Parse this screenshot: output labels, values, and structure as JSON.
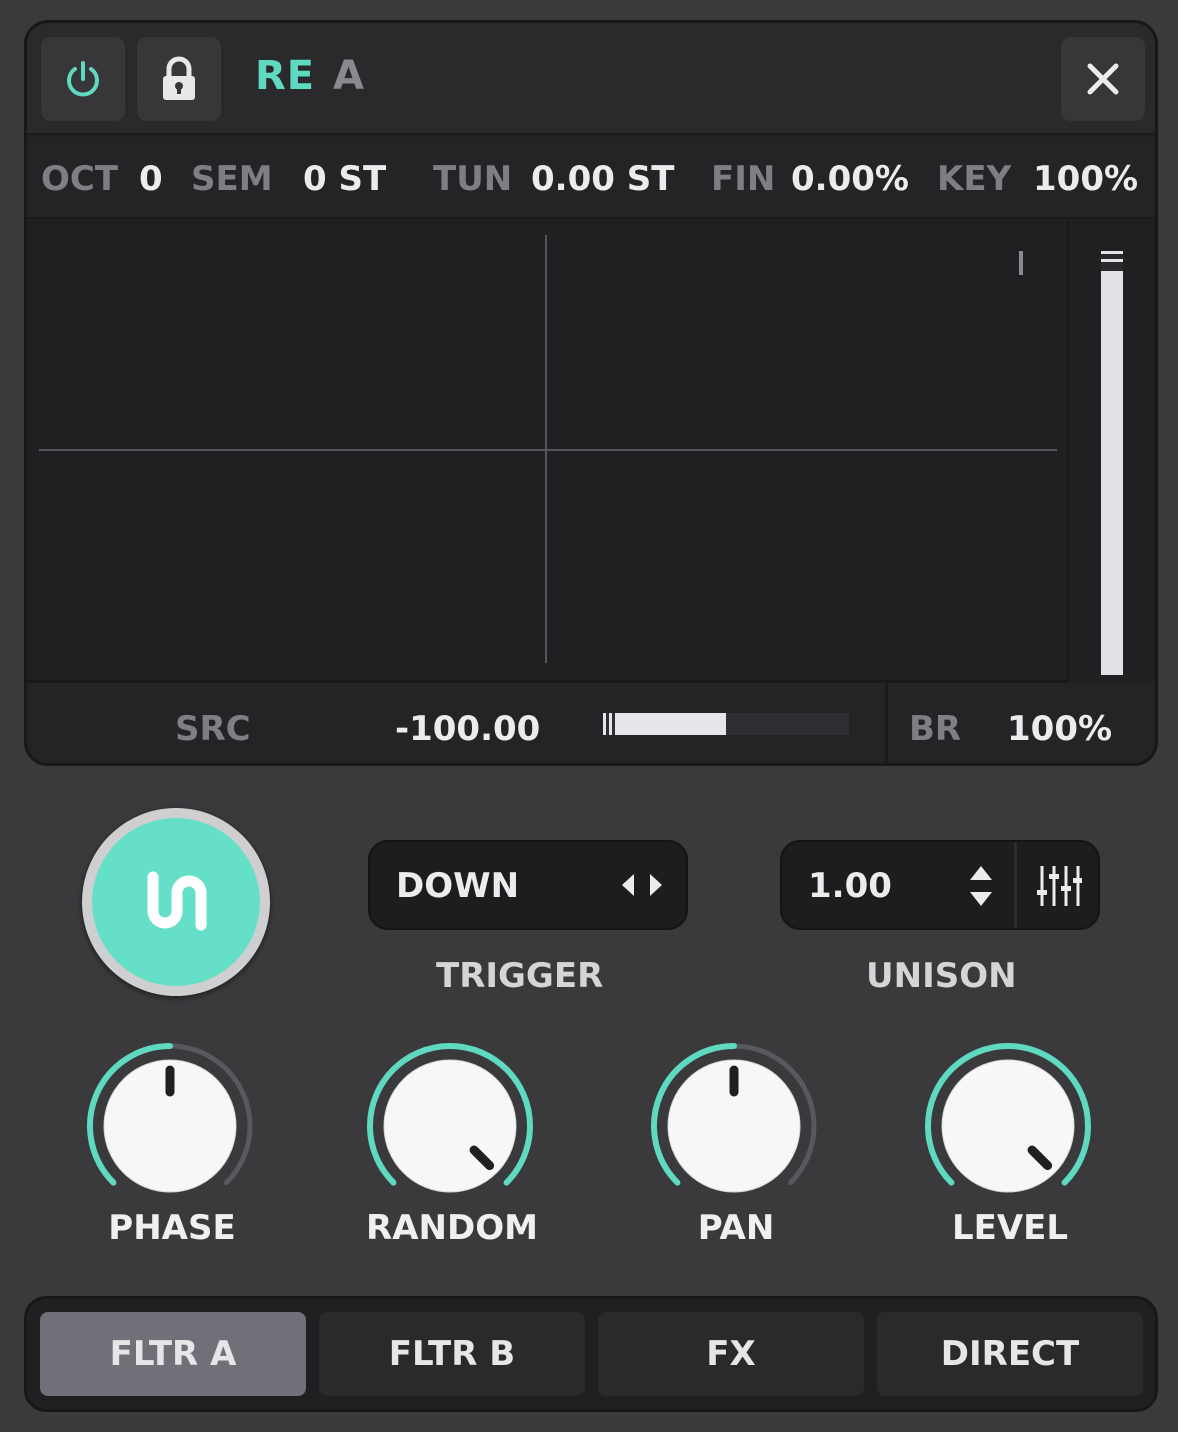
{
  "header": {
    "title_main": "RE",
    "title_sub": "A",
    "icons": [
      "power-icon",
      "lock-icon",
      "close-icon"
    ]
  },
  "params": {
    "oct_label": "OCT",
    "oct_value": "0",
    "sem_label": "SEM",
    "sem_value": "0 ST",
    "tun_label": "TUN",
    "tun_value": "0.00 ST",
    "fin_label": "FIN",
    "fin_value": "0.00%",
    "key_label": "KEY",
    "key_value": "100%"
  },
  "meter": {
    "level": 1.0
  },
  "source": {
    "src_label": "SRC",
    "src_value": "-100.00",
    "bar_fraction": 0.5,
    "br_label": "BR",
    "br_value": "100%"
  },
  "trigger": {
    "value": "DOWN",
    "caption": "TRIGGER"
  },
  "unison": {
    "value": "1.00",
    "caption": "UNISON"
  },
  "knobs": [
    {
      "label": "PHASE",
      "value": 0.5
    },
    {
      "label": "RANDOM",
      "value": 1.0
    },
    {
      "label": "PAN",
      "value": 0.5
    },
    {
      "label": "LEVEL",
      "value": 1.0
    }
  ],
  "tabs": [
    {
      "label": "FLTR A",
      "active": true
    },
    {
      "label": "FLTR B",
      "active": false
    },
    {
      "label": "FX",
      "active": false
    },
    {
      "label": "DIRECT",
      "active": false
    }
  ],
  "colors": {
    "accent": "#5fd9c0",
    "knob_arc_inactive": "#59595d",
    "panel_bg": "#202023"
  }
}
